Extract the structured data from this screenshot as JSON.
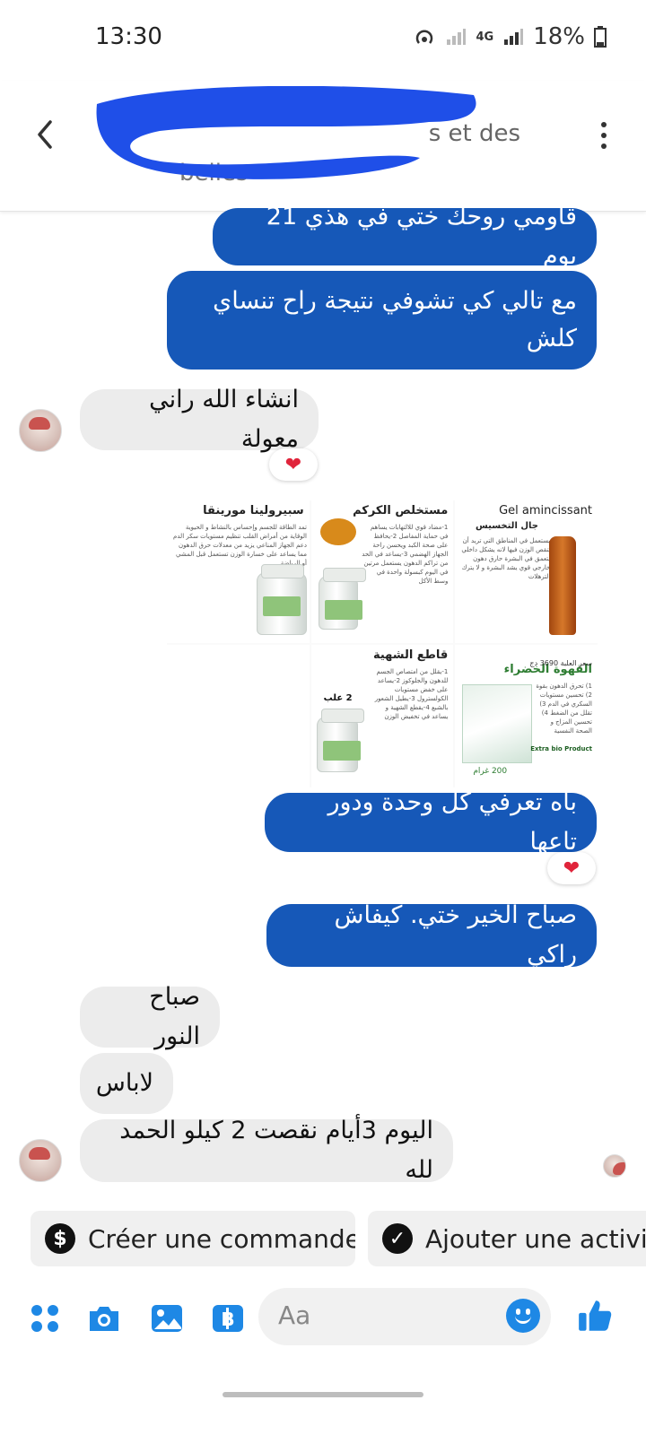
{
  "status_bar": {
    "time": "13:30",
    "network": "4G",
    "battery": "18%"
  },
  "header": {
    "title_visible": "s et des",
    "title_line2": "belles"
  },
  "messages": [
    {
      "side": "out",
      "text": "قاومي روحك ختي في هذي 21 يوم"
    },
    {
      "side": "out",
      "text": "مع تالي كي تشوفي نتيجة راح تنساي كلش"
    },
    {
      "side": "in",
      "text": "انشاء الله راني معولة",
      "reaction": "heart"
    },
    {
      "side": "out",
      "type": "image"
    },
    {
      "side": "out",
      "text": "باه تعرفي كل وحدة ودور تاعها",
      "reaction": "heart"
    },
    {
      "side": "out",
      "text": "صباح الخير ختي. كيفاش راكي"
    },
    {
      "side": "in",
      "text": "صباح النور"
    },
    {
      "side": "in",
      "text": "لاباس"
    },
    {
      "side": "in",
      "text": "اليوم 3أيام نقصت 2 كيلو الحمد لله"
    }
  ],
  "product_image": {
    "panels": [
      {
        "title": "Gel amincissant",
        "subtitle": "جال التخسيس",
        "text": "يستعمل في المناطق التي تريد أن تنقص الوزن فيها لانه يشكل داخلي يتعمق في البشرة حارق دهون خارجي قوي يشد البشرة و لا يترك الترهلات"
      },
      {
        "title": "مستخلص الكركم",
        "text": "1-مضاد قوي للالتهابات يساهم في حماية المفاصل 2-يحافظ على صحة الكبد ويحسن راحة الجهاز الهضمي 3-يساعد في الحد من تراكم الدهون يستعمل مرتين في اليوم كبسولة واحدة في وسط الأكل"
      },
      {
        "title": "سبيرولينا مورينقا",
        "text": "تمد الطاقة للجسم وإحساس بالنشاط و الحيوية الوقاية من أمراض القلب تنظيم مستويات سكر الدم دعم الجهاز المناعي يزيد من معدلات حرق الدهون مما يساعد على خسارة الوزن تستعمل قبل المشي أو الرياضة"
      },
      {
        "title": "القهوة الخضراء",
        "price": "سعر العلبة 3690 دج",
        "weight": "200 غرام",
        "badge": "Extra bio Product",
        "text": "1) تحرق الدهون بقوة 2) تحسين مستويات السكري في الدم 3) تقلل من الضغط 4) تحسين المزاج و الصحة النفسية"
      },
      {
        "title": "قاطع الشهية",
        "count": "2 علب",
        "text": "1-يقلل من امتصاص الجسم للدهون والجلوكوز 2-يساعد على خفض مستويات الكولسترول 3-يطيل الشعور بالشبع 4-يقطع الشهية و يساعد في تخفيض الوزن"
      },
      {
        "title": "",
        "text": ""
      }
    ]
  },
  "quick_replies": [
    {
      "label": "Créer une commande",
      "icon": "dollar-icon"
    },
    {
      "label": "Ajouter une activi",
      "icon": "check-icon"
    }
  ],
  "composer": {
    "placeholder": "Aa"
  },
  "colors": {
    "accent": "#1658b8",
    "incoming": "#ececec",
    "messenger_blue": "#1e88e5"
  }
}
